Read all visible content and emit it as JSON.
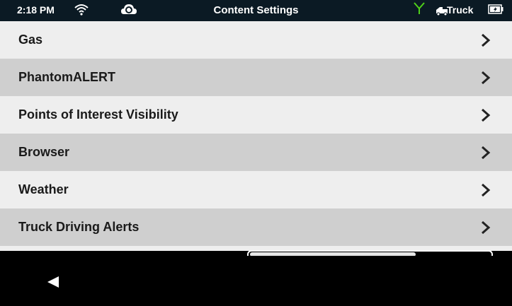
{
  "status_bar": {
    "time": "2:18 PM",
    "title": "Content Settings",
    "profile": "Truck",
    "icons": [
      "wifi-icon",
      "cloud-sync-icon",
      "signal-icon",
      "truck-icon",
      "battery-icon"
    ],
    "colors": {
      "background": "#0b1a24",
      "signal": "#4fd11a",
      "text": "#ffffff"
    }
  },
  "menu": {
    "items": [
      {
        "label": "Gas"
      },
      {
        "label": "PhantomALERT"
      },
      {
        "label": "Points of Interest Visibility"
      },
      {
        "label": "Browser"
      },
      {
        "label": "Weather"
      },
      {
        "label": "Truck Driving Alerts"
      }
    ],
    "colors": {
      "row_light": "#eeeeee",
      "row_dark": "#cfcfcf",
      "text": "#1a1a1a"
    }
  },
  "nav_bar": {
    "icons": [
      "back-icon"
    ]
  }
}
